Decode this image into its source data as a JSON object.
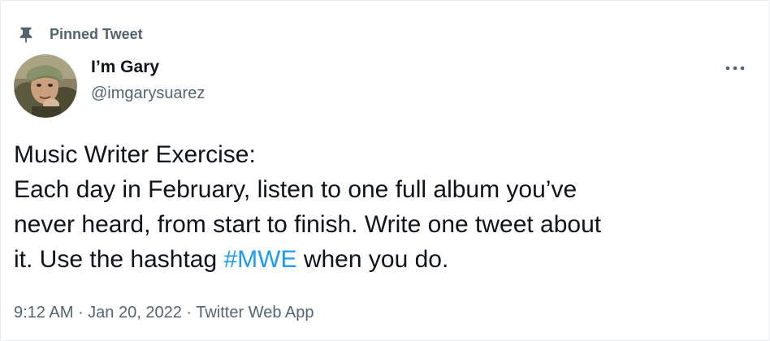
{
  "pinned": {
    "icon": "pin-icon",
    "label": "Pinned Tweet"
  },
  "author": {
    "avatar_icon": "user-avatar",
    "name": "I’m Gary",
    "handle": "@imgarysuarez"
  },
  "more_icon": "more-horizontal-icon",
  "tweet": {
    "line1": "Music Writer Exercise:",
    "line2": "Each day in February, listen to one full album you’ve",
    "line3": "never heard, from start to finish. Write one tweet about",
    "line4_before": "it. Use the hashtag ",
    "hashtag": "#MWE",
    "line4_after": " when you do."
  },
  "meta": {
    "time": "9:12 AM",
    "separator": " · ",
    "date": "Jan 20, 2022",
    "source": "Twitter Web App"
  },
  "colors": {
    "text_primary": "#0f1419",
    "text_secondary": "#536471",
    "link_blue": "#1d9bf0"
  }
}
